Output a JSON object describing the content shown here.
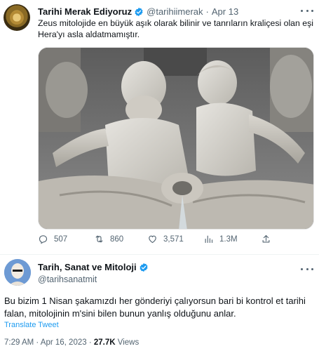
{
  "quoted_tweet": {
    "author_name": "Tarihi Merak Ediyoruz",
    "handle": "@tarihiimerak",
    "separator": "·",
    "date": "Apr 13",
    "text": "Zeus mitolojide en büyük aşık olarak bilinir ve tanrıların kraliçesi olan eşi Hera'yı asla aldatmamıştır.",
    "media_icon": "statue-photo",
    "actions": {
      "replies": "507",
      "retweets": "860",
      "likes": "3,571",
      "views": "1.3M"
    }
  },
  "main_tweet": {
    "author_name": "Tarih, Sanat ve Mitoloji",
    "handle": "@tarihsanatmit",
    "text": "Bu bizim 1 Nisan şakamızdı her gönderiyi çalıyorsun bari bi kontrol et tarihi falan, mitolojinin m'sini bilen bunun yanlış olduğunu anlar.",
    "translate_label": "Translate Tweet",
    "time": "7:29 AM · Apr 16, 2023 ·",
    "views_count": "27.7K",
    "views_label": "Views"
  },
  "colors": {
    "verified": "#1d9bf0",
    "link": "#1d9bf0",
    "muted": "#536471",
    "text": "#0f1419"
  }
}
